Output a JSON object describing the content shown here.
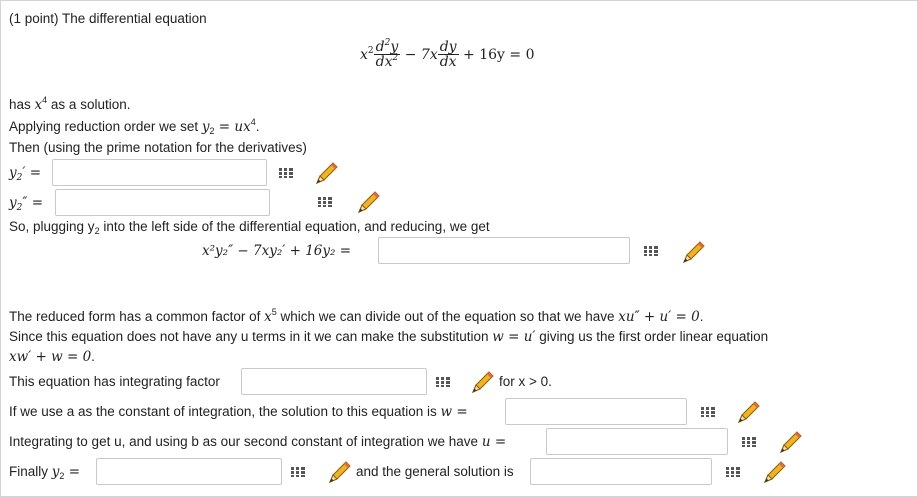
{
  "problem": {
    "header": "(1 point) The differential equation",
    "equation": {
      "coef1": "x",
      "d2y": "d",
      "y": "y",
      "dx2": "dx",
      "minus": "−",
      "coef2": "7x",
      "dy": "dy",
      "dx": "dx",
      "rest": "+ 16y = 0"
    },
    "solution_pre": "has ",
    "solution_math": "x",
    "solution_exp": "4",
    "solution_post": " as a solution.",
    "reduction_pre": "Applying reduction order we set ",
    "reduction_math": "y",
    "reduction_sub": "2",
    "reduction_eq": " = ux",
    "reduction_exp": "4",
    "reduction_end": ".",
    "prime_note": "Then (using the prime notation for the derivatives)",
    "y2p_label": "y",
    "y2pp_label": "y",
    "plug_text": "So, plugging y",
    "plug_sub": "2",
    "plug_text_end": " into the left side of the differential equation, and reducing, we get",
    "reduced_lhs": "x²y₂″ − 7xy₂′ + 16y₂ =",
    "common_factor_pre": "The reduced form has a common factor of ",
    "common_factor_math": "x",
    "common_factor_exp": "5",
    "common_factor_mid": " which we can divide out of the equation so that we have ",
    "common_factor_eq": "xu″ + u′ = 0",
    "common_factor_end": ".",
    "subst_pre": "Since this equation does not have any u terms in it we can make the substitution ",
    "subst_math": "w = u′",
    "subst_post": " giving us the first order linear equation",
    "first_order_eq": "xw′ + w = 0",
    "first_order_end": ".",
    "integrating_factor_label": "This equation has integrating factor",
    "integrating_factor_suffix": "for x > 0.",
    "solution_w_label": "If we use a as the constant of integration, the solution to this equation is ",
    "solution_w_math": "w =",
    "integrate_u_label": "Integrating to get u, and using b as our second constant of integration we have ",
    "integrate_u_math": "u =",
    "finally_label": "Finally ",
    "finally_math": "y",
    "finally_sub": "2",
    "finally_eq": " =",
    "general_label": "and the general solution is"
  },
  "inputs": {
    "y2_prime": "",
    "y2_double_prime": "",
    "reduced_form": "",
    "integrating_factor": "",
    "w_solution": "",
    "u_solution": "",
    "y2_final": "",
    "general_solution": ""
  },
  "icons": {
    "math_tool": "matrix-grid-icon",
    "answer_preview": "pencil-icon"
  },
  "colors": {
    "pencil_body": "#f2b321",
    "pencil_tip": "#e06a3b",
    "border": "#c9c9c9"
  }
}
